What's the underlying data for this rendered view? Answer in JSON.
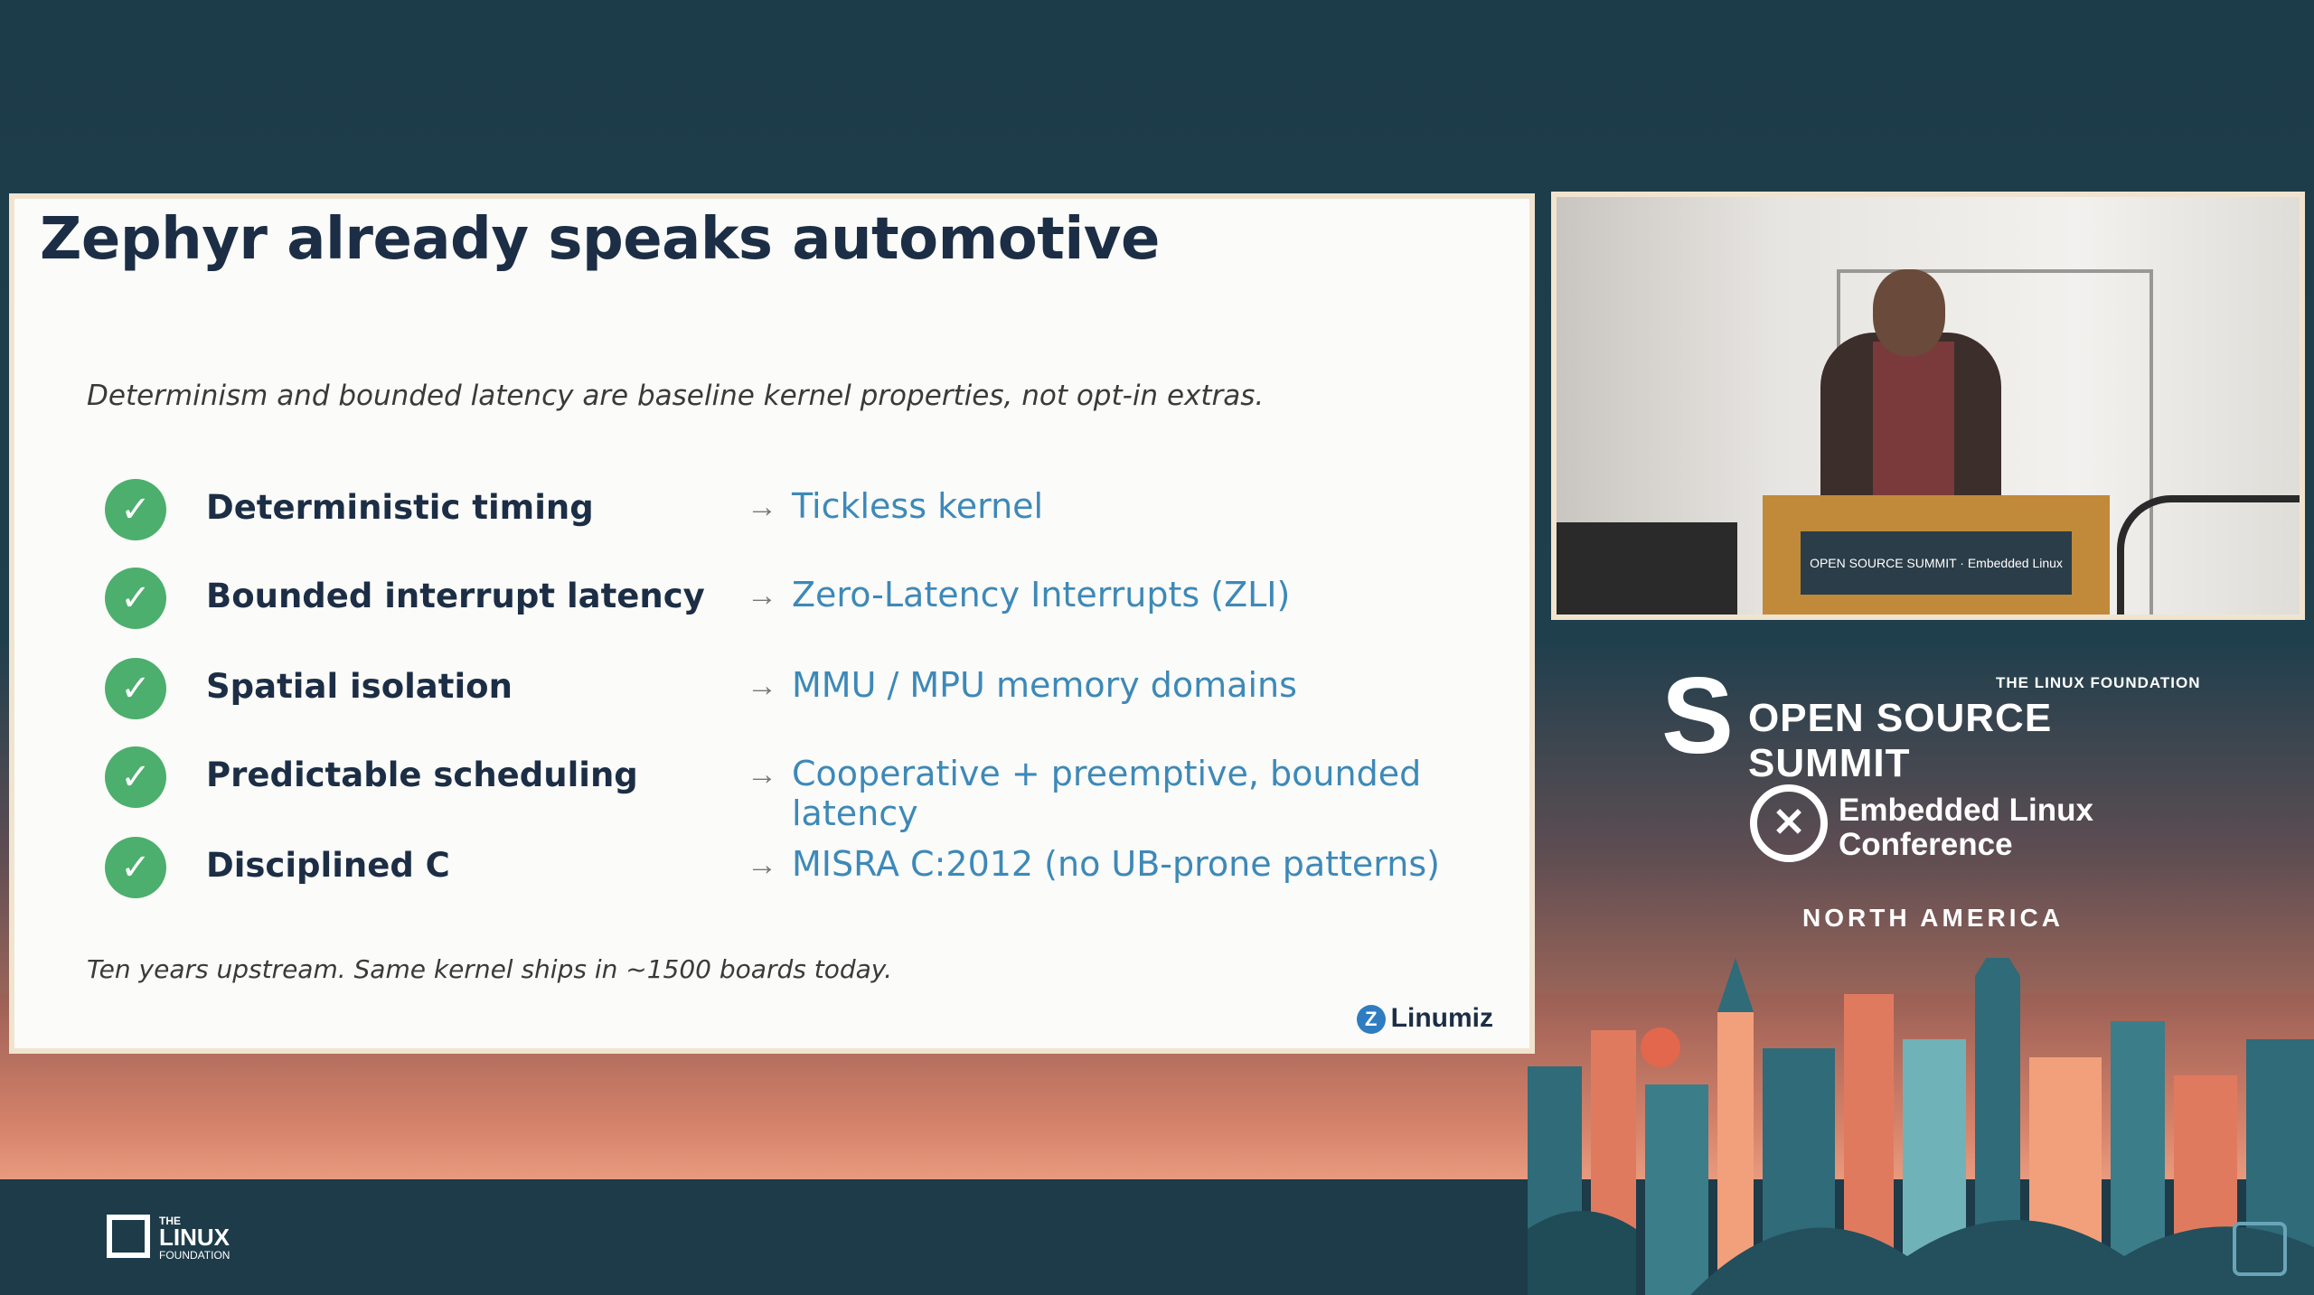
{
  "slide": {
    "title": "Zephyr already speaks automotive",
    "subtitle": "Determinism and bounded latency are baseline kernel properties, not opt-in extras.",
    "rows": [
      {
        "feature": "Deterministic timing",
        "arrow": "→",
        "mapping": "Tickless kernel"
      },
      {
        "feature": "Bounded interrupt latency",
        "arrow": "→",
        "mapping": "Zero-Latency Interrupts (ZLI)"
      },
      {
        "feature": "Spatial isolation",
        "arrow": "→",
        "mapping": "MMU / MPU memory domains"
      },
      {
        "feature": "Predictable scheduling",
        "arrow": "→",
        "mapping": "Cooperative + preemptive, bounded latency"
      },
      {
        "feature": "Disciplined C",
        "arrow": "→",
        "mapping": "MISRA C:2012 (no UB-prone patterns)"
      }
    ],
    "check_glyph": "✓",
    "footnote": "Ten years upstream. Same kernel ships in ~1500 boards today.",
    "brand": "Linumiz",
    "brand_mark": "Z"
  },
  "video": {
    "podium_sign": "OPEN SOURCE SUMMIT · Embedded Linux Conference"
  },
  "conference": {
    "lf_label": "THE LINUX FOUNDATION",
    "oss_name": "OPEN SOURCE SUMMIT",
    "oss_mark": "S",
    "elc_line1": "Embedded Linux",
    "elc_line2": "Conference",
    "elc_mark": "✕",
    "region": "NORTH AMERICA"
  },
  "footer": {
    "lf_the": "THE",
    "lf_linux": "LINUX",
    "lf_foundation": "FOUNDATION"
  },
  "colors": {
    "accent_check": "#4caf6d",
    "link_blue": "#3d89b8",
    "title_navy": "#1c2e45",
    "background": "#1e3d4b"
  }
}
